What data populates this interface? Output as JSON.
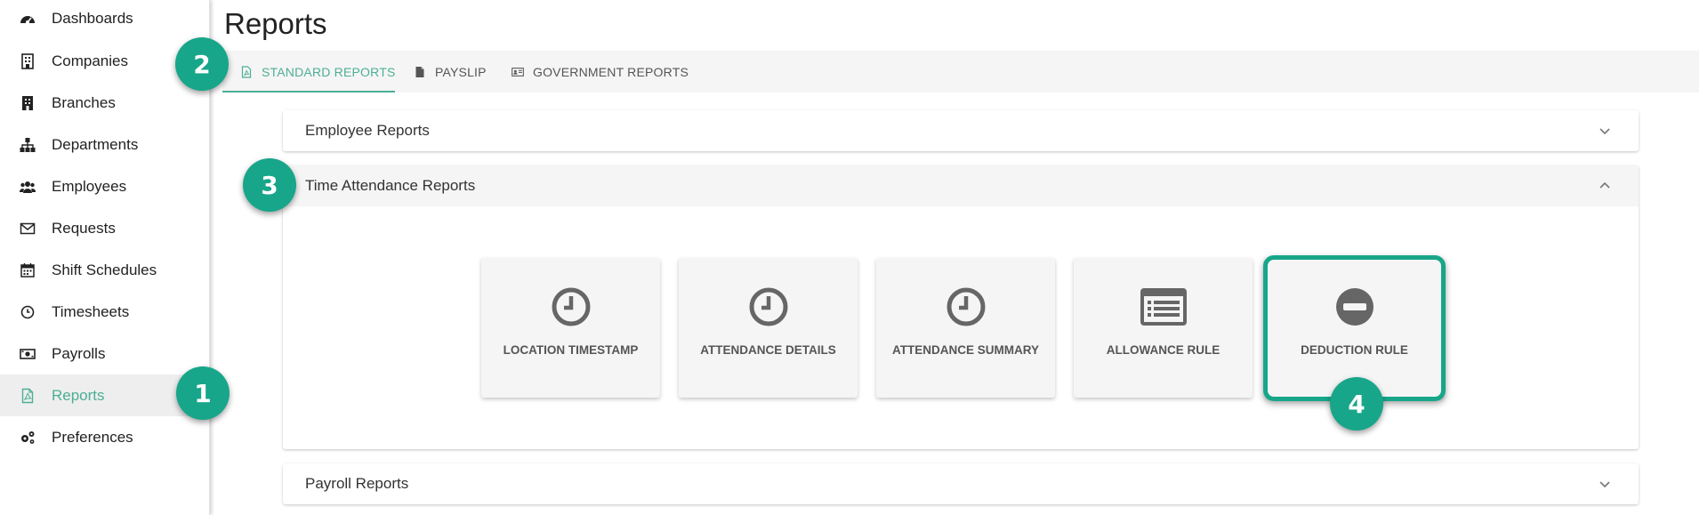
{
  "sidebar": {
    "items": [
      {
        "label": "Dashboards",
        "icon": "dashboard-icon"
      },
      {
        "label": "Companies",
        "icon": "building-icon"
      },
      {
        "label": "Branches",
        "icon": "branch-building-icon"
      },
      {
        "label": "Departments",
        "icon": "org-chart-icon"
      },
      {
        "label": "Employees",
        "icon": "users-icon"
      },
      {
        "label": "Requests",
        "icon": "envelope-icon"
      },
      {
        "label": "Shift Schedules",
        "icon": "calendar-icon"
      },
      {
        "label": "Timesheets",
        "icon": "clock-icon"
      },
      {
        "label": "Payrolls",
        "icon": "money-icon"
      },
      {
        "label": "Reports",
        "icon": "pdf-file-icon",
        "active": true
      },
      {
        "label": "Preferences",
        "icon": "gears-icon"
      }
    ]
  },
  "page": {
    "title": "Reports"
  },
  "tabs": [
    {
      "label": "STANDARD REPORTS",
      "icon": "pdf-file-icon",
      "active": true
    },
    {
      "label": "PAYSLIP",
      "icon": "file-icon"
    },
    {
      "label": "GOVERNMENT REPORTS",
      "icon": "id-card-icon"
    }
  ],
  "sections": {
    "employee": {
      "title": "Employee Reports",
      "expanded": false
    },
    "time_attendance": {
      "title": "Time Attendance Reports",
      "expanded": true
    },
    "payroll": {
      "title": "Payroll Reports",
      "expanded": false
    }
  },
  "report_cards": [
    {
      "label": "LOCATION TIMESTAMP",
      "icon": "clock-icon"
    },
    {
      "label": "ATTENDANCE DETAILS",
      "icon": "clock-icon"
    },
    {
      "label": "ATTENDANCE SUMMARY",
      "icon": "clock-icon"
    },
    {
      "label": "ALLOWANCE RULE",
      "icon": "list-icon"
    },
    {
      "label": "DEDUCTION RULE",
      "icon": "minus-circle-icon",
      "highlighted": true
    }
  ],
  "badges": [
    "1",
    "2",
    "3",
    "4"
  ],
  "colors": {
    "accent": "#4caf94",
    "badge": "#17a68a",
    "icon": "#666666",
    "card_bg": "#f5f5f5"
  }
}
